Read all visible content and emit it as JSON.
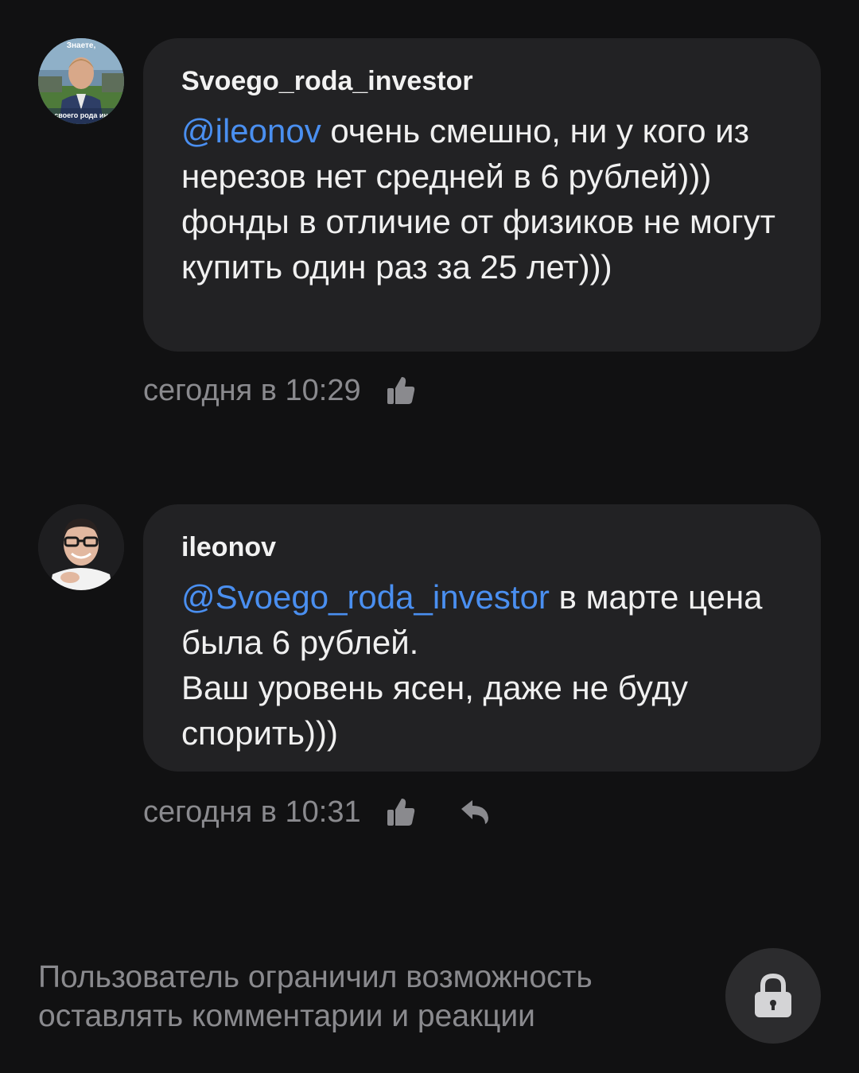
{
  "comments": [
    {
      "author": "Svoego_roda_investor",
      "avatar_icon": "user-avatar-photo",
      "avatar_caption_top": "Знаете,",
      "avatar_caption_bottom": "своего рода ин",
      "mention": "@ileonov",
      "text": " очень смешно, ни у кого из нерезов нет средней в 6 рублей))) фонды в отличие от физиков не могут купить один раз за 25 лет)))",
      "timestamp": "сегодня в 10:29",
      "actions": [
        "like-icon"
      ]
    },
    {
      "author": "ileonov",
      "avatar_icon": "user-avatar-photo",
      "mention": "@Svoego_roda_investor",
      "text": " в марте цена была 6 рублей.\nВаш уровень ясен, даже не буду спорить)))",
      "timestamp": "сегодня в 10:31",
      "actions": [
        "like-icon",
        "reply-icon"
      ]
    }
  ],
  "footer": {
    "restriction_text": "Пользователь ограничил возможность оставлять комментарии и реакции",
    "lock_icon": "lock-icon"
  },
  "colors": {
    "background": "#111112",
    "bubble": "#222224",
    "mention": "#4a8ff0",
    "muted": "#8a8a8e"
  }
}
